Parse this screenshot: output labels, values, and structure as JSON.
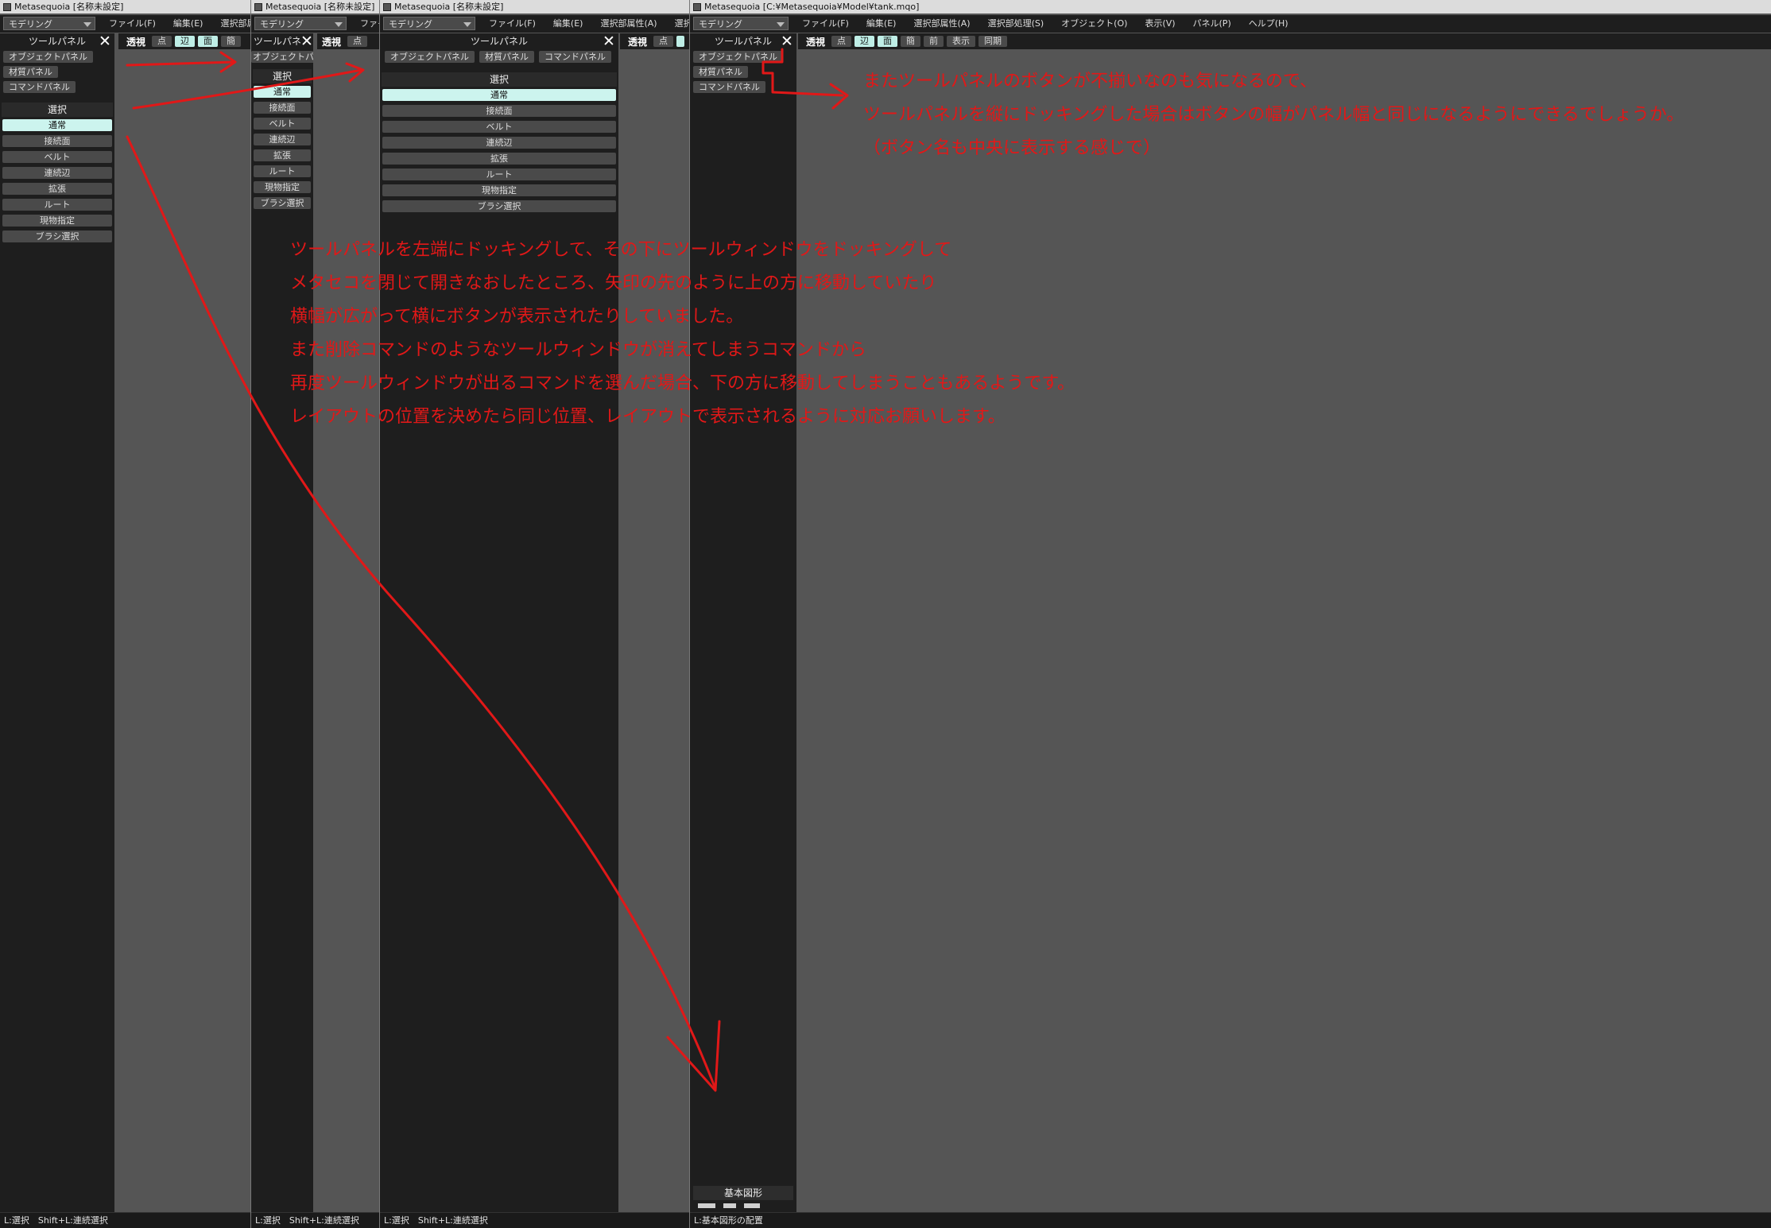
{
  "colors": {
    "accent_button": "#ccf4ee",
    "annotation_red": "#e11818",
    "viewport_gray": "#555555"
  },
  "windows": [
    {
      "title": "Metasequoia [名称未設定]",
      "mode": "モデリング",
      "menus": [
        "ファイル(F)",
        "編集(E)",
        "選択部属性(A)"
      ],
      "panel_title": "ツールパネル",
      "panel_buttons": [
        "オブジェクトパネル",
        "材質パネル",
        "コマンドパネル"
      ],
      "section": "選択",
      "tools": [
        "通常",
        "接続面",
        "ベルト",
        "連続辺",
        "拡張",
        "ルート",
        "現物指定",
        "ブラシ選択"
      ],
      "view_label": "透視",
      "view_buttons": [
        "点",
        "辺",
        "面",
        "簡"
      ],
      "status": "L:選択　Shift+L:連続選択"
    },
    {
      "title": "Metasequoia [名称未設定]",
      "mode": "モデリング",
      "menus": [
        "ファイ"
      ],
      "panel_title": "ツールパネ",
      "panel_buttons": [
        "オブジェクトパネ"
      ],
      "section": "選択",
      "tools": [
        "通常",
        "接続面",
        "ベルト",
        "連続辺",
        "拡張",
        "ルート",
        "現物指定",
        "ブラシ選択"
      ],
      "view_label": "透視",
      "view_buttons": [
        "点"
      ],
      "status": "L:選択　Shift+L:連続選択"
    },
    {
      "title": "Metasequoia [名称未設定]",
      "mode": "モデリング",
      "menus": [
        "ファイル(F)",
        "編集(E)",
        "選択部属性(A)",
        "選択"
      ],
      "panel_title": "ツールパネル",
      "panel_buttons": [
        "オブジェクトパネル",
        "材質パネル",
        "コマンドパネル"
      ],
      "section": "選択",
      "tools": [
        "通常",
        "接続面",
        "ベルト",
        "連続辺",
        "拡張",
        "ルート",
        "現物指定",
        "ブラシ選択"
      ],
      "view_label": "透視",
      "view_buttons": [
        "点",
        ""
      ],
      "status": "L:選択　Shift+L:連続選択"
    },
    {
      "title": "Metasequoia [C:¥Metasequoia¥Model¥tank.mqo]",
      "mode": "モデリング",
      "menus": [
        "ファイル(F)",
        "編集(E)",
        "選択部属性(A)",
        "選択部処理(S)",
        "オブジェクト(O)",
        "表示(V)",
        "パネル(P)",
        "ヘルプ(H)"
      ],
      "panel_title": "ツールパネル",
      "panel_buttons": [
        "オブジェクトパネル",
        "材質パネル",
        "コマンドパネル"
      ],
      "view_label": "透視",
      "view_buttons": [
        "点",
        "辺",
        "面",
        "簡",
        "前",
        "表示",
        "同期"
      ],
      "bottom_panel": "基本図形",
      "status": "L:基本図形の配置"
    }
  ],
  "annotations": {
    "right": [
      "またツールパネルのボタンが不揃いなのも気になるので、",
      "ツールパネルを縦にドッキングした場合はボタンの幅がパネル幅と同じになるようにできるでしょうか。",
      "（ボタン名も中央に表示する感じで）"
    ],
    "center": [
      "ツールパネルを左端にドッキングして、その下にツールウィンドウをドッキングして",
      "メタセコを閉じて開きなおしたところ、矢印の先のように上の方に移動していたり",
      "横幅が広がって横にボタンが表示されたりしていました。",
      "また削除コマンドのようなツールウィンドウが消えてしまうコマンドから",
      "再度ツールウィンドウが出るコマンドを選んだ場合、下の方に移動してしまうこともあるようです。",
      "レイアウトの位置を決めたら同じ位置、レイアウトで表示されるように対応お願いします。"
    ]
  }
}
